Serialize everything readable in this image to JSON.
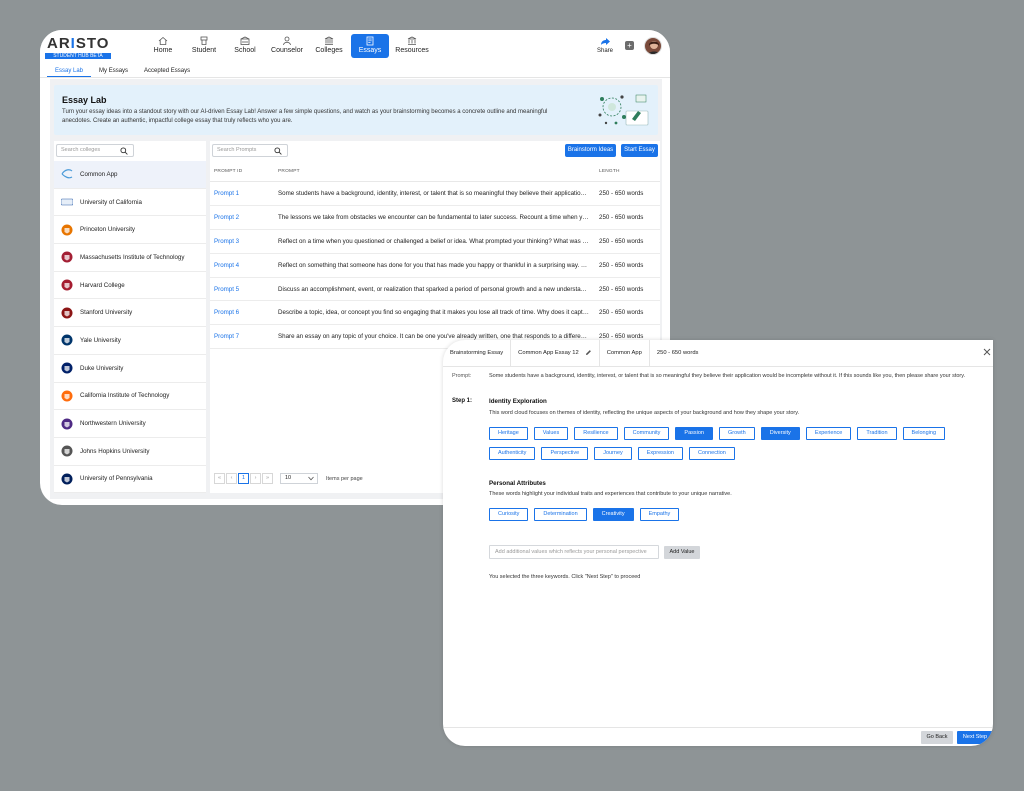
{
  "app": {
    "logo_main": "AR",
    "logo_accent": "I",
    "logo_end": "STO",
    "logo_badge": "STUDENT HUB BETA"
  },
  "nav": [
    {
      "label": "Home",
      "icon": "home-icon"
    },
    {
      "label": "Student",
      "icon": "student-icon"
    },
    {
      "label": "School",
      "icon": "school-icon"
    },
    {
      "label": "Counselor",
      "icon": "counselor-icon"
    },
    {
      "label": "Colleges",
      "icon": "colleges-icon"
    },
    {
      "label": "Essays",
      "icon": "essays-icon",
      "active": true
    },
    {
      "label": "Resources",
      "icon": "resources-icon"
    }
  ],
  "header": {
    "share_label": "Share"
  },
  "subtabs": [
    "Essay Lab",
    "My Essays",
    "Accepted Essays"
  ],
  "banner": {
    "title": "Essay Lab",
    "description": "Turn your essay ideas into a standout story with our AI-driven Essay Lab! Answer a few simple questions, and watch as your brainstorming becomes a concrete outline and meaningful anecdotes. Create an authentic, impactful college essay that truly reflects who you are."
  },
  "colleges": {
    "search_placeholder": "Search colleges",
    "items": [
      {
        "name": "Common App",
        "color": "#4a9ad8"
      },
      {
        "name": "University of California",
        "color": "#2b5fa8"
      },
      {
        "name": "Princeton University",
        "color": "#e77500"
      },
      {
        "name": "Massachusetts Institute of Technology",
        "color": "#a31f34"
      },
      {
        "name": "Harvard College",
        "color": "#a51c30"
      },
      {
        "name": "Stanford University",
        "color": "#8c1515"
      },
      {
        "name": "Yale University",
        "color": "#00356b"
      },
      {
        "name": "Duke University",
        "color": "#012169"
      },
      {
        "name": "California Institute of Technology",
        "color": "#ff6c0c"
      },
      {
        "name": "Northwestern University",
        "color": "#4e2a84"
      },
      {
        "name": "Johns Hopkins University",
        "color": "#555555"
      },
      {
        "name": "University of Pennsylvania",
        "color": "#011f5b"
      }
    ]
  },
  "prompts": {
    "search_placeholder": "Search Prompts",
    "brainstorm_label": "Brainstorm Ideas",
    "start_label": "Start Essay",
    "headers": {
      "id": "PROMPT ID",
      "prompt": "PROMPT",
      "length": "LENGTH"
    },
    "rows": [
      {
        "id": "Prompt 1",
        "text": "Some students have a background, identity, interest, or talent that is so meaningful they believe their application would be incomplete without it.",
        "length": "250 - 650 words"
      },
      {
        "id": "Prompt 2",
        "text": "The lessons we take from obstacles we encounter can be fundamental to later success. Recount a time when you faced a challenge, setback, or failure.",
        "length": "250 - 650 words"
      },
      {
        "id": "Prompt 3",
        "text": "Reflect on a time when you questioned or challenged a belief or idea. What prompted your thinking? What was the outcome?",
        "length": "250 - 650 words"
      },
      {
        "id": "Prompt 4",
        "text": "Reflect on something that someone has done for you that has made you happy or thankful in a surprising way. How has this gratitude affected you?",
        "length": "250 - 650 words"
      },
      {
        "id": "Prompt 5",
        "text": "Discuss an accomplishment, event, or realization that sparked a period of personal growth and a new understanding of yourself or others.",
        "length": "250 - 650 words"
      },
      {
        "id": "Prompt 6",
        "text": "Describe a topic, idea, or concept you find so engaging that it makes you lose all track of time. Why does it captivate you?",
        "length": "250 - 650 words"
      },
      {
        "id": "Prompt 7",
        "text": "Share an essay on any topic of your choice. It can be one you've already written, one that responds to a different prompt, or one of your own design.",
        "length": "250 - 650 words"
      }
    ],
    "page": "1",
    "per_page": "10",
    "per_page_label": "Items per page"
  },
  "brainstorm": {
    "tabs": [
      "Brainstorming Essay",
      "Common App Essay 12",
      "Common App",
      "250 - 650 words"
    ],
    "prompt_label": "Prompt:",
    "prompt_text": "Some students have a background, identity, interest, or talent that is so meaningful they believe their application would be incomplete without it. If this sounds like you, then please share your story.",
    "step_label": "Step 1:",
    "section1": {
      "title": "Identity Exploration",
      "desc": "This word cloud focuses on themes of identity, reflecting the unique aspects of your background and how they shape your story.",
      "chips": [
        {
          "label": "Heritage",
          "selected": false
        },
        {
          "label": "Values",
          "selected": false
        },
        {
          "label": "Resilience",
          "selected": false
        },
        {
          "label": "Community",
          "selected": false
        },
        {
          "label": "Passion",
          "selected": true
        },
        {
          "label": "Growth",
          "selected": false
        },
        {
          "label": "Diversity",
          "selected": true
        },
        {
          "label": "Experience",
          "selected": false
        },
        {
          "label": "Tradition",
          "selected": false
        },
        {
          "label": "Belonging",
          "selected": false
        },
        {
          "label": "Authenticity",
          "selected": false
        },
        {
          "label": "Perspective",
          "selected": false
        },
        {
          "label": "Journey",
          "selected": false
        },
        {
          "label": "Expression",
          "selected": false
        },
        {
          "label": "Connection",
          "selected": false
        }
      ]
    },
    "section2": {
      "title": "Personal Attributes",
      "desc": "These words highlight your individual traits and experiences that contribute to your unique narrative.",
      "chips": [
        {
          "label": "Curiosity",
          "selected": false
        },
        {
          "label": "Determination",
          "selected": false
        },
        {
          "label": "Creativity",
          "selected": true
        },
        {
          "label": "Empathy",
          "selected": false
        }
      ]
    },
    "add_placeholder": "Add additional values which reflects your personal perspective",
    "add_button": "Add Value",
    "note": "You selected the three keywords. Click \"Next Step\" to proceed",
    "go_back": "Go Back",
    "next_step": "Next Step"
  }
}
